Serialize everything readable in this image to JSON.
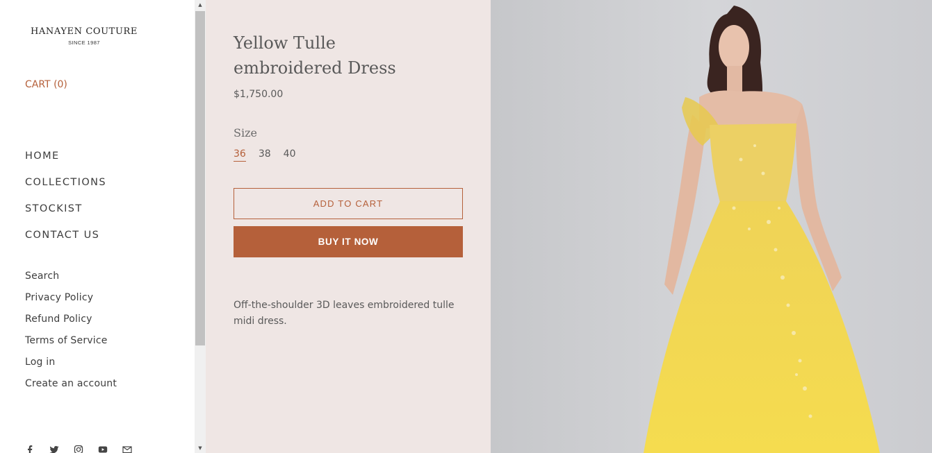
{
  "sidebar": {
    "logo": {
      "brand": "HANAYEN COUTURE",
      "tagline": "SINCE 1987"
    },
    "cart": "CART (0)",
    "main_nav": [
      "HOME",
      "COLLECTIONS",
      "STOCKIST",
      "CONTACT US"
    ],
    "sub_nav": [
      "Search",
      "Privacy Policy",
      "Refund Policy",
      "Terms of Service",
      "Log in",
      "Create an account"
    ],
    "social_icons": [
      "facebook-icon",
      "twitter-icon",
      "instagram-icon",
      "youtube-icon",
      "email-icon"
    ]
  },
  "product": {
    "title": "Yellow Tulle embroidered Dress",
    "price": "$1,750.00",
    "size_label": "Size",
    "sizes": [
      "36",
      "38",
      "40"
    ],
    "selected_size": "36",
    "add_to_cart": "ADD TO CART",
    "buy_now": "BUY IT NOW",
    "description": "Off-the-shoulder 3D leaves embroidered tulle midi dress."
  },
  "colors": {
    "accent": "#b5603a",
    "product_panel_bg": "#efe6e4",
    "photo_bg": "#cfd0d3",
    "dress": "#f2d64a"
  }
}
